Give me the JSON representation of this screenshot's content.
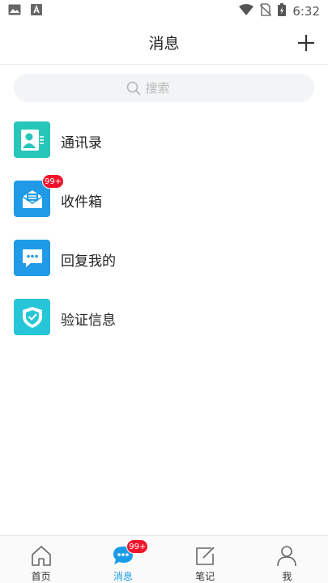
{
  "status_bar": {
    "time": "6:32"
  },
  "header": {
    "title": "消息"
  },
  "search": {
    "placeholder": "搜索"
  },
  "list": {
    "items": [
      {
        "label": "通讯录",
        "icon": "contacts-icon",
        "color": "#26c6b8"
      },
      {
        "label": "收件箱",
        "icon": "inbox-icon",
        "color": "#1e9ae6",
        "badge": "99+"
      },
      {
        "label": "回复我的",
        "icon": "reply-icon",
        "color": "#1e9ae6"
      },
      {
        "label": "验证信息",
        "icon": "shield-icon",
        "color": "#26c6d8"
      }
    ]
  },
  "tabbar": {
    "tabs": [
      {
        "label": "首页",
        "icon": "home-icon"
      },
      {
        "label": "消息",
        "icon": "chat-icon",
        "active": true,
        "badge": "99+"
      },
      {
        "label": "笔记",
        "icon": "note-icon"
      },
      {
        "label": "我",
        "icon": "profile-icon"
      }
    ]
  },
  "colors": {
    "accent": "#1a9be8",
    "badge": "#f0142b"
  }
}
